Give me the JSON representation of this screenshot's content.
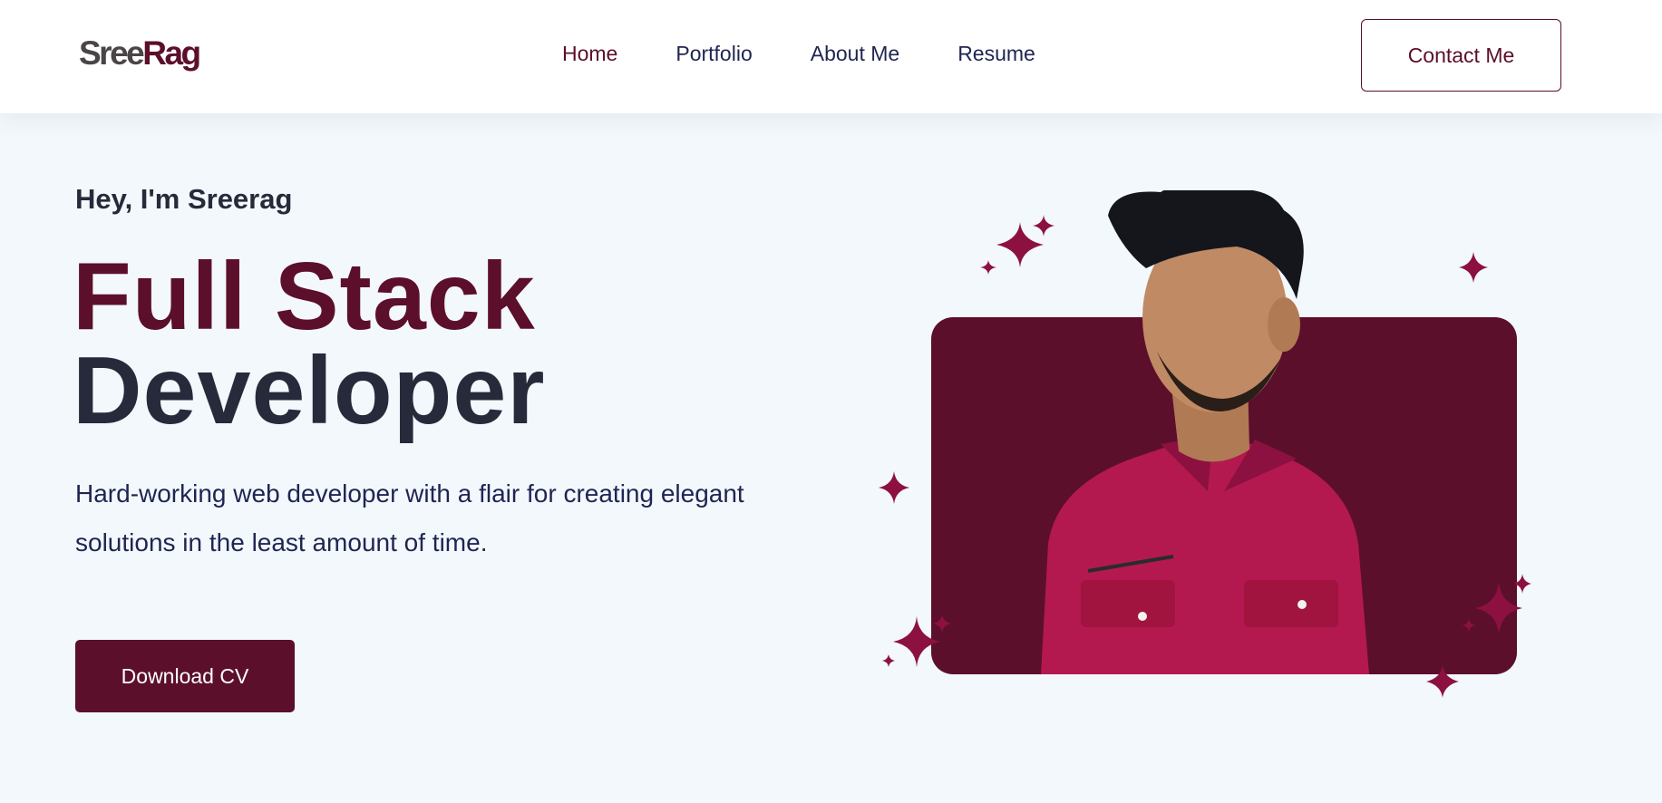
{
  "header": {
    "logo": {
      "part1": "Sree",
      "part2": "Rag"
    },
    "nav": [
      {
        "label": "Home",
        "active": true
      },
      {
        "label": "Portfolio",
        "active": false
      },
      {
        "label": "About Me",
        "active": false
      },
      {
        "label": "Resume",
        "active": false
      }
    ],
    "contact_label": "Contact Me"
  },
  "hero": {
    "greeting": "Hey, I'm Sreerag",
    "title_line1": "Full Stack",
    "title_line2": "Developer",
    "description": "Hard-working web developer with a flair for creating elegant solutions in the least amount of time.",
    "download_label": "Download CV"
  },
  "colors": {
    "brand": "#5c0f2b",
    "dark_text": "#272a3a",
    "nav_text": "#1f2552",
    "background": "#f3f8fc",
    "sparkle": "#8c1140",
    "shirt": "#b3194f"
  },
  "icons": [
    "sparkle-icon"
  ]
}
